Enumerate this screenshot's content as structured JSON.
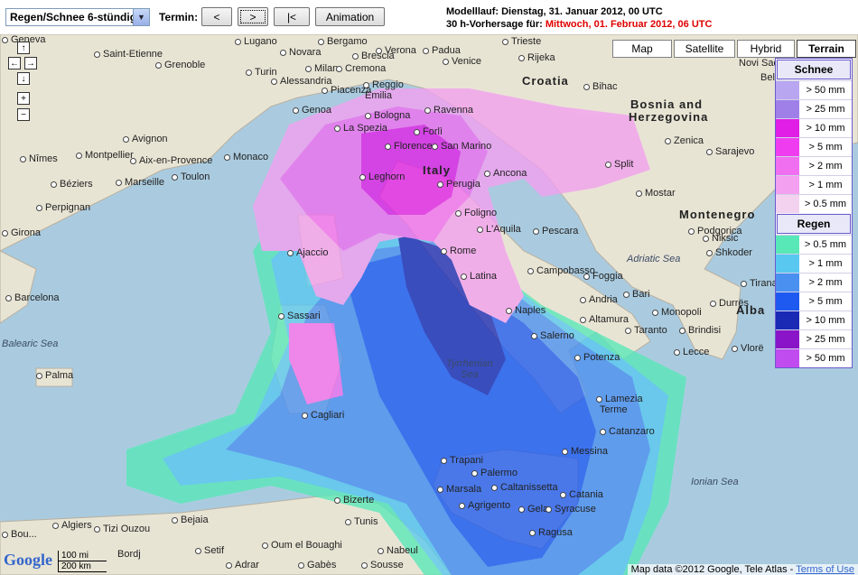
{
  "toolbar": {
    "product_select": "Regen/Schnee 6-stündig",
    "termin_label": "Termin:",
    "prev_label": "<",
    "next_label": ">",
    "first_label": "|<",
    "animation_label": "Animation"
  },
  "run_info": {
    "line1": "Modelllauf: Dienstag, 31. Januar 2012, 00 UTC",
    "line2_prefix": "30 h-Vorhersage für: ",
    "line2_date": "Mittwoch, 01. Februar 2012, 06 UTC"
  },
  "map_types": [
    "Map",
    "Satellite",
    "Hybrid",
    "Terrain"
  ],
  "map_type_selected": "Terrain",
  "nav": {
    "up": "↑",
    "left": "←",
    "right": "→",
    "down": "↓",
    "zoom_in": "+",
    "zoom_out": "−"
  },
  "legend": {
    "snow_title": "Schnee",
    "snow": [
      {
        "label": "> 50 mm",
        "color": "#b9a6f0"
      },
      {
        "label": "> 25 mm",
        "color": "#9f7fe8"
      },
      {
        "label": "> 10 mm",
        "color": "#e01ee6"
      },
      {
        "label": "> 5 mm",
        "color": "#f03cf0"
      },
      {
        "label": "> 2 mm",
        "color": "#f06ef0"
      },
      {
        "label": "> 1 mm",
        "color": "#f3a0f0"
      },
      {
        "label": "> 0.5 mm",
        "color": "#f3d2f0"
      }
    ],
    "rain_title": "Regen",
    "rain": [
      {
        "label": "> 0.5 mm",
        "color": "#58e8b8"
      },
      {
        "label": "> 1 mm",
        "color": "#58c8f0"
      },
      {
        "label": "> 2 mm",
        "color": "#4a90f0"
      },
      {
        "label": "> 5 mm",
        "color": "#1e5af0"
      },
      {
        "label": "> 10 mm",
        "color": "#1a2ab4"
      },
      {
        "label": "> 25 mm",
        "color": "#8a14c8"
      },
      {
        "label": "> 50 mm",
        "color": "#c04cf0"
      }
    ]
  },
  "map_labels": {
    "countries": [
      "Croatia",
      "Bosnia and",
      "Herzegovina",
      "Montenegro",
      "Italy",
      "Alba"
    ],
    "seas": [
      "Balearic Sea",
      "Tyrrhenian",
      "Sea",
      "Adriatic Sea",
      "Ionian Sea"
    ],
    "cities": [
      "Geneva",
      "Lugano",
      "Bergamo",
      "Brescia",
      "Padua",
      "Venice",
      "Trieste",
      "Rijeka",
      "Grenoble",
      "Saint-Etienne",
      "Turin",
      "Novara",
      "Milan",
      "Cremona",
      "Verona",
      "Alessandria",
      "Reggio",
      "Piacenza",
      "Emilia",
      "Genoa",
      "Bologna",
      "Ravenna",
      "La Spezia",
      "Forlì",
      "Florence",
      "San Marino",
      "Leghorn",
      "Perugia",
      "Ancona",
      "Split",
      "Bihac",
      "Zenica",
      "Sarajevo",
      "Mostar",
      "Niksic",
      "Podgorica",
      "Shkoder",
      "Tirana",
      "Durrës",
      "Vlorë",
      "Bari",
      "Andria",
      "Foggia",
      "Pescara",
      "L'Aquila",
      "Foligno",
      "Rome",
      "Latina",
      "Campobasso",
      "Naples",
      "Altamura",
      "Monopoli",
      "Taranto",
      "Brindisi",
      "Lecce",
      "Salerno",
      "Potenza",
      "Ajaccio",
      "Sassari",
      "Cagliari",
      "Lamezia",
      "Terme",
      "Catanzaro",
      "Messina",
      "Palermo",
      "Trapani",
      "Marsala",
      "Caltanissetta",
      "Agrigento",
      "Catania",
      "Gela",
      "Syracuse",
      "Ragusa",
      "Montpellier",
      "Nîmes",
      "Aix-en-Provence",
      "Monaco",
      "Marseille",
      "Toulon",
      "Avignon",
      "Béziers",
      "Perpignan",
      "Girona",
      "Barcelona",
      "Palma",
      "Algiers",
      "Tizi Ouzou",
      "Bejaia",
      "Setif",
      "Bizerte",
      "Tunis",
      "Bordj",
      "Nabeul",
      "Sousse",
      "Oum el Bouaghi",
      "Bou...",
      "Adrar",
      "Gabès"
    ],
    "nearby": [
      "Novi Sad",
      "Bel..."
    ]
  },
  "footer": {
    "attribution": "Map data ©2012 Google, Tele Atlas - ",
    "terms": "Terms of Use"
  },
  "scale": {
    "mi": "100 mi",
    "km": "200 km"
  },
  "logo": "Google"
}
